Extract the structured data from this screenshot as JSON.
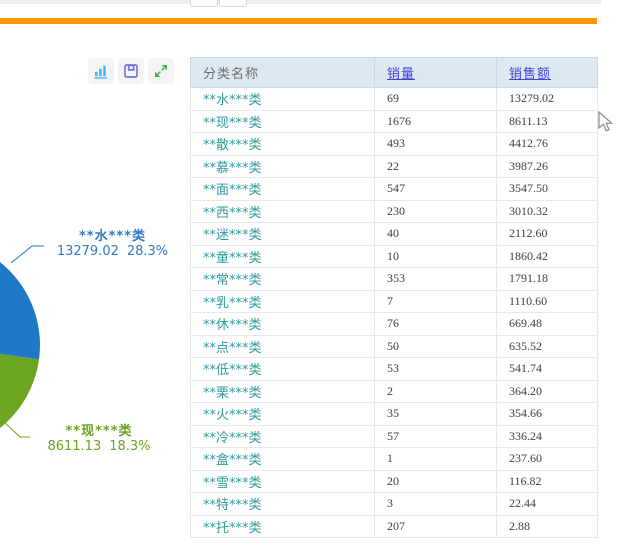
{
  "window": {
    "top_strip_color": "#eeeeec",
    "accent_bar_color": "#ff9800"
  },
  "toolbar": {
    "chart_icon_color": "#45b8e8",
    "save_icon_color": "#7273dc",
    "expand_icon_color": "#39b54a"
  },
  "chart_data": {
    "type": "pie",
    "title": "",
    "legend_position": "none",
    "slices": [
      {
        "label": "**水***类",
        "value": "13279.02",
        "percent": "28.3%",
        "color": "#2079c8",
        "text_color": "#2e7cc3"
      },
      {
        "label": "**现***类",
        "value": "8611.13",
        "percent": "18.3%",
        "color": "#6ca522",
        "text_color": "#6da023"
      }
    ]
  },
  "table": {
    "headers": [
      "分类名称",
      "销量",
      "销售额"
    ],
    "rows": [
      [
        "**水***类",
        "69",
        "13279.02"
      ],
      [
        "**现***类",
        "1676",
        "8611.13"
      ],
      [
        "**散***类",
        "493",
        "4412.76"
      ],
      [
        "**慕***类",
        "22",
        "3987.26"
      ],
      [
        "**面***类",
        "547",
        "3547.50"
      ],
      [
        "**西***类",
        "230",
        "3010.32"
      ],
      [
        "**迷***类",
        "40",
        "2112.60"
      ],
      [
        "**童***类",
        "10",
        "1860.42"
      ],
      [
        "**常***类",
        "353",
        "1791.18"
      ],
      [
        "**乳***类",
        "7",
        "1110.60"
      ],
      [
        "**休***类",
        "76",
        "669.48"
      ],
      [
        "**点***类",
        "50",
        "635.52"
      ],
      [
        "**低***类",
        "53",
        "541.74"
      ],
      [
        "**栗***类",
        "2",
        "364.20"
      ],
      [
        "**火***类",
        "35",
        "354.66"
      ],
      [
        "**冷***类",
        "57",
        "336.24"
      ],
      [
        "**盒***类",
        "1",
        "237.60"
      ],
      [
        "**雪***类",
        "20",
        "116.82"
      ],
      [
        "**特***类",
        "3",
        "22.44"
      ],
      [
        "**托***类",
        "207",
        "2.88"
      ]
    ]
  }
}
